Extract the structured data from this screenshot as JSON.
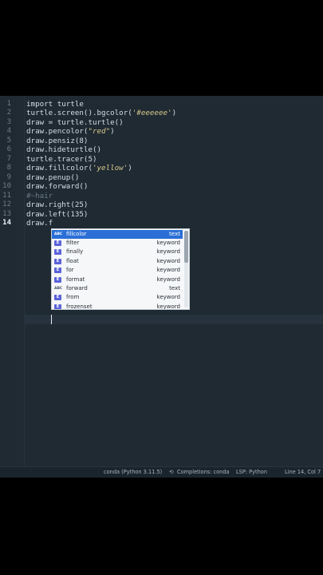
{
  "editor": {
    "line_numbers": [
      "1",
      "2",
      "3",
      "4",
      "5",
      "6",
      "7",
      "8",
      "9",
      "10",
      "11",
      "12",
      "13",
      "14"
    ],
    "active_line": "14",
    "lines": [
      {
        "parts": [
          {
            "t": "import turtle",
            "c": ""
          }
        ]
      },
      {
        "parts": [
          {
            "t": "turtle.screen().bgcolor(",
            "c": ""
          },
          {
            "t": "'#eeeeee'",
            "c": "str"
          },
          {
            "t": ")",
            "c": ""
          }
        ]
      },
      {
        "parts": [
          {
            "t": "draw = turtle.turtle()",
            "c": ""
          }
        ]
      },
      {
        "parts": [
          {
            "t": "draw.pencolor(",
            "c": ""
          },
          {
            "t": "\"red\"",
            "c": "str"
          },
          {
            "t": ")",
            "c": ""
          }
        ]
      },
      {
        "parts": [
          {
            "t": "draw.pensiz(8)",
            "c": ""
          }
        ]
      },
      {
        "parts": [
          {
            "t": "draw.hideturtle()",
            "c": ""
          }
        ]
      },
      {
        "parts": [
          {
            "t": "turtle.tracer(5)",
            "c": ""
          }
        ]
      },
      {
        "parts": [
          {
            "t": "draw.fillcolor(",
            "c": ""
          },
          {
            "t": "'yellow'",
            "c": "str"
          },
          {
            "t": ")",
            "c": ""
          }
        ]
      },
      {
        "parts": [
          {
            "t": "draw.penup()",
            "c": ""
          }
        ]
      },
      {
        "parts": [
          {
            "t": "draw.forward()",
            "c": ""
          }
        ]
      },
      {
        "parts": [
          {
            "t": "#~hair",
            "c": "cmt"
          }
        ]
      },
      {
        "parts": [
          {
            "t": "draw.right(25)",
            "c": ""
          }
        ]
      },
      {
        "parts": [
          {
            "t": "draw.left(135)",
            "c": ""
          }
        ]
      },
      {
        "parts": [
          {
            "t": "draw.f",
            "c": ""
          }
        ]
      }
    ]
  },
  "autocomplete": {
    "items": [
      {
        "badge": "ABC",
        "badge_type": "text",
        "label": "fillcolor",
        "kind": "text",
        "selected": true
      },
      {
        "badge": "E",
        "badge_type": "keyword",
        "label": "filter",
        "kind": "keyword",
        "selected": false
      },
      {
        "badge": "E",
        "badge_type": "keyword",
        "label": "finally",
        "kind": "keyword",
        "selected": false
      },
      {
        "badge": "E",
        "badge_type": "keyword",
        "label": "float",
        "kind": "keyword",
        "selected": false
      },
      {
        "badge": "E",
        "badge_type": "keyword",
        "label": "for",
        "kind": "keyword",
        "selected": false
      },
      {
        "badge": "E",
        "badge_type": "keyword",
        "label": "format",
        "kind": "keyword",
        "selected": false
      },
      {
        "badge": "ABC",
        "badge_type": "text",
        "label": "forward",
        "kind": "text",
        "selected": false
      },
      {
        "badge": "E",
        "badge_type": "keyword",
        "label": "from",
        "kind": "keyword",
        "selected": false
      },
      {
        "badge": "E",
        "badge_type": "keyword",
        "label": "frozenset",
        "kind": "keyword",
        "selected": false
      }
    ]
  },
  "statusbar": {
    "env": "conda (Python 3.11.5)",
    "completions_icon": "sync-icon",
    "completions": "Completions: conda",
    "lsp": "LSP: Python",
    "position": "Line 14, Col 7"
  },
  "colors": {
    "editor_bg": "#1f2a33",
    "selection": "#2b6fd6",
    "keyword_badge": "#5b63d9"
  }
}
